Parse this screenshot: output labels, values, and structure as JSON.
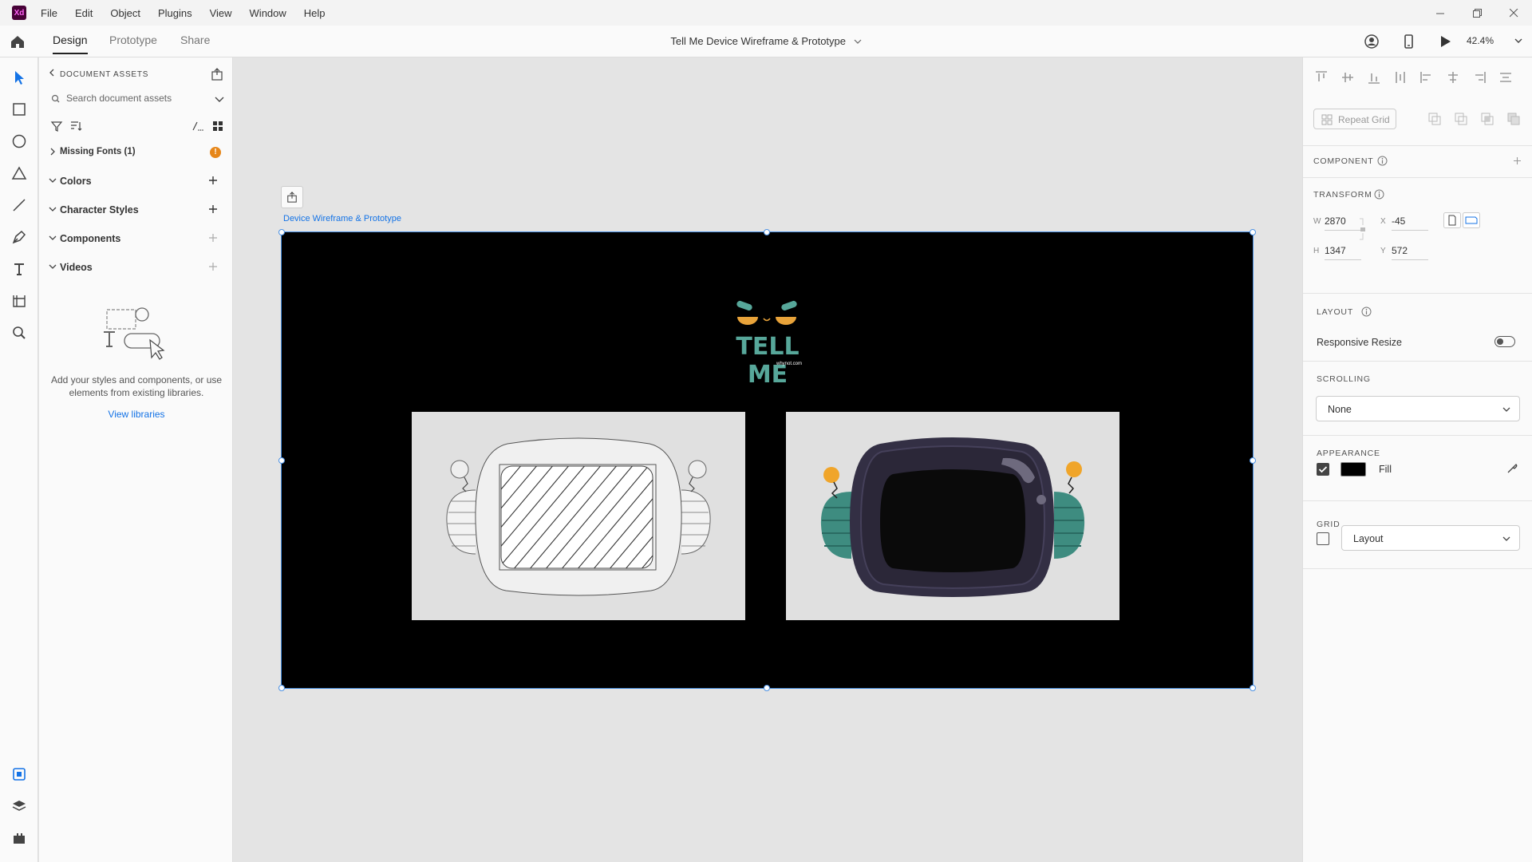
{
  "app": {
    "logo_text": "Xd",
    "menu": [
      "File",
      "Edit",
      "Object",
      "Plugins",
      "View",
      "Window",
      "Help"
    ]
  },
  "toolbar": {
    "tabs": [
      "Design",
      "Prototype",
      "Share"
    ],
    "active_tab": "Design",
    "document_title": "Tell Me Device Wireframe & Prototype",
    "zoom": "42.4%"
  },
  "assets": {
    "header": "DOCUMENT ASSETS",
    "search_placeholder": "Search document assets",
    "sections": [
      {
        "label": "Missing Fonts (1)",
        "badge": "!"
      },
      {
        "label": "Colors"
      },
      {
        "label": "Character Styles"
      },
      {
        "label": "Components"
      },
      {
        "label": "Videos"
      }
    ],
    "empty_text": "Add your styles and components, or use elements from existing libraries.",
    "view_libraries": "View libraries"
  },
  "canvas": {
    "artboard_name": "Device Wireframe & Prototype",
    "logo_title": "TELL ME",
    "logo_subtitle": "whynot.com"
  },
  "inspector": {
    "repeat_grid": "Repeat Grid",
    "component_label": "COMPONENT",
    "transform_label": "TRANSFORM",
    "w_label": "W",
    "w_value": "2870",
    "x_label": "X",
    "x_value": "-45",
    "h_label": "H",
    "h_value": "1347",
    "y_label": "Y",
    "y_value": "572",
    "layout_label": "LAYOUT",
    "responsive_resize": "Responsive Resize",
    "scrolling_label": "SCROLLING",
    "scrolling_value": "None",
    "appearance_label": "APPEARANCE",
    "fill_label": "Fill",
    "fill_color": "#000000",
    "grid_label": "GRID",
    "grid_value": "Layout"
  },
  "colors": {
    "accent": "#1473e6",
    "logo_teal": "#57a79a",
    "warning": "#e68619"
  }
}
